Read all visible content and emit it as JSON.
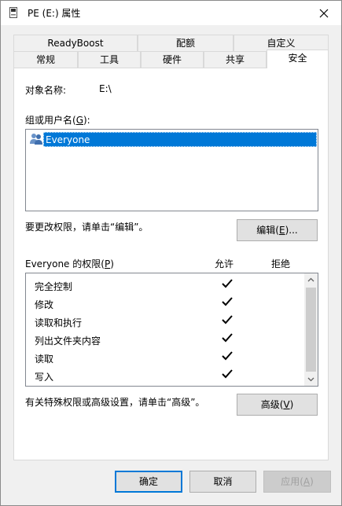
{
  "window": {
    "title": "PE (E:) 属性",
    "close_icon": "close-icon",
    "drive_icon": "drive-icon"
  },
  "tabs_back": [
    {
      "label": "ReadyBoost"
    },
    {
      "label": "配额"
    },
    {
      "label": "自定义"
    }
  ],
  "tabs_front": [
    {
      "label": "常规"
    },
    {
      "label": "工具"
    },
    {
      "label": "硬件"
    },
    {
      "label": "共享"
    },
    {
      "label": "安全",
      "active": true
    }
  ],
  "security": {
    "object_name_label": "对象名称:",
    "object_name_value": "E:\\",
    "group_label_prefix": "组或用户名(",
    "group_label_key": "G",
    "group_label_suffix": "):",
    "users": [
      {
        "name": "Everyone",
        "icon": "users-group-icon",
        "selected": true
      }
    ],
    "change_perm_text": "要更改权限，请单击“编辑”。",
    "edit_button_prefix": "编辑(",
    "edit_button_key": "E",
    "edit_button_suffix": ")...",
    "perm_header_prefix": "Everyone 的权限(",
    "perm_header_key": "P",
    "perm_header_suffix": ")",
    "allow_header": "允许",
    "deny_header": "拒绝",
    "permissions": [
      {
        "name": "完全控制",
        "allow": true,
        "deny": false
      },
      {
        "name": "修改",
        "allow": true,
        "deny": false
      },
      {
        "name": "读取和执行",
        "allow": true,
        "deny": false
      },
      {
        "name": "列出文件夹内容",
        "allow": true,
        "deny": false
      },
      {
        "name": "读取",
        "allow": true,
        "deny": false
      },
      {
        "name": "写入",
        "allow": true,
        "deny": false
      }
    ],
    "advanced_text": "有关特殊权限或高级设置，请单击“高级”。",
    "advanced_button_prefix": "高级(",
    "advanced_button_key": "V",
    "advanced_button_suffix": ")"
  },
  "footer": {
    "ok_label": "确定",
    "cancel_label": "取消",
    "apply_prefix": "应用(",
    "apply_key": "A",
    "apply_suffix": ")"
  },
  "colors": {
    "accent": "#0078d7",
    "window_bg": "#f0f0f0",
    "panel_bg": "#ffffff"
  }
}
